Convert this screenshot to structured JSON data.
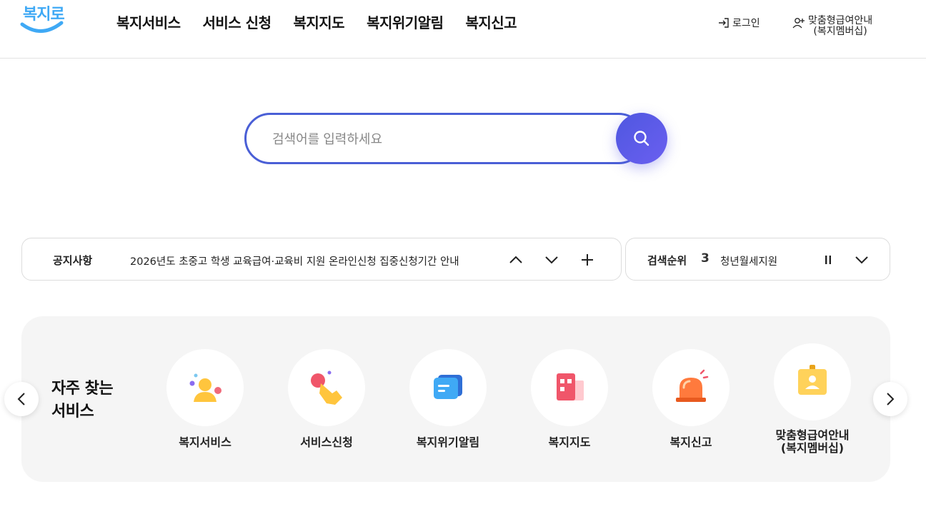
{
  "header": {
    "logo_text": "복지로",
    "nav": [
      "복지서비스",
      "서비스 신청",
      "복지지도",
      "복지위기알림",
      "복지신고"
    ],
    "login_label": "로그인",
    "member_line1": "맞춤형급여안내",
    "member_line2": "(복지멤버십)"
  },
  "search": {
    "placeholder": "검색어를 입력하세요"
  },
  "notice": {
    "label": "공지사항",
    "text": "2026년도 초중고 학생 교육급여·교육비 지원 온라인신청 집중신청기간 안내"
  },
  "rank": {
    "label": "검색순위",
    "number": "3",
    "keyword": "청년월세지원"
  },
  "frequent": {
    "title_line1": "자주 찾는",
    "title_line2": "서비스",
    "items": [
      {
        "label": "복지서비스",
        "icon": "person-icon"
      },
      {
        "label": "서비스신청",
        "icon": "hand-tap-icon"
      },
      {
        "label": "복지위기알림",
        "icon": "message-icon"
      },
      {
        "label": "복지지도",
        "icon": "building-icon"
      },
      {
        "label": "복지신고",
        "icon": "siren-icon"
      },
      {
        "label": "맞춤형급여안내\n(복지멤버십)",
        "icon": "id-card-icon"
      }
    ]
  },
  "colors": {
    "accent": "#4a5fd6",
    "logo": "#3fa9f5",
    "panel_bg": "#f5f5f5"
  }
}
